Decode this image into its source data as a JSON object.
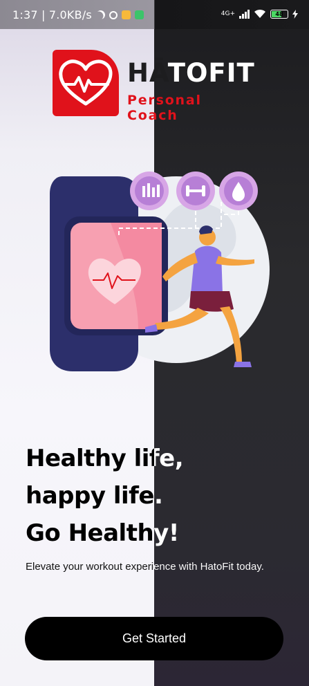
{
  "status_bar": {
    "time_speed": "1:37 | 7.0KB/s",
    "network": "4G+",
    "battery": "48"
  },
  "logo": {
    "brand_part1": "HĀ",
    "brand_part2": "TOFIT",
    "tagline": "Personal Coach"
  },
  "hero": {
    "icons": [
      "bar-chart-icon",
      "dumbbell-icon",
      "water-drop-icon"
    ]
  },
  "headline": {
    "line1": "Healthy life,",
    "line2": "happy life.",
    "line3": "Go Healthy!"
  },
  "subtitle": "Elevate your workout experience with HatoFit today.",
  "cta": {
    "label": "Get Started"
  },
  "colors": {
    "brand_red": "#e0121b",
    "dark_panel": "#2a2a2d",
    "button": "#000000",
    "accent_purple": "#b77fd6"
  }
}
